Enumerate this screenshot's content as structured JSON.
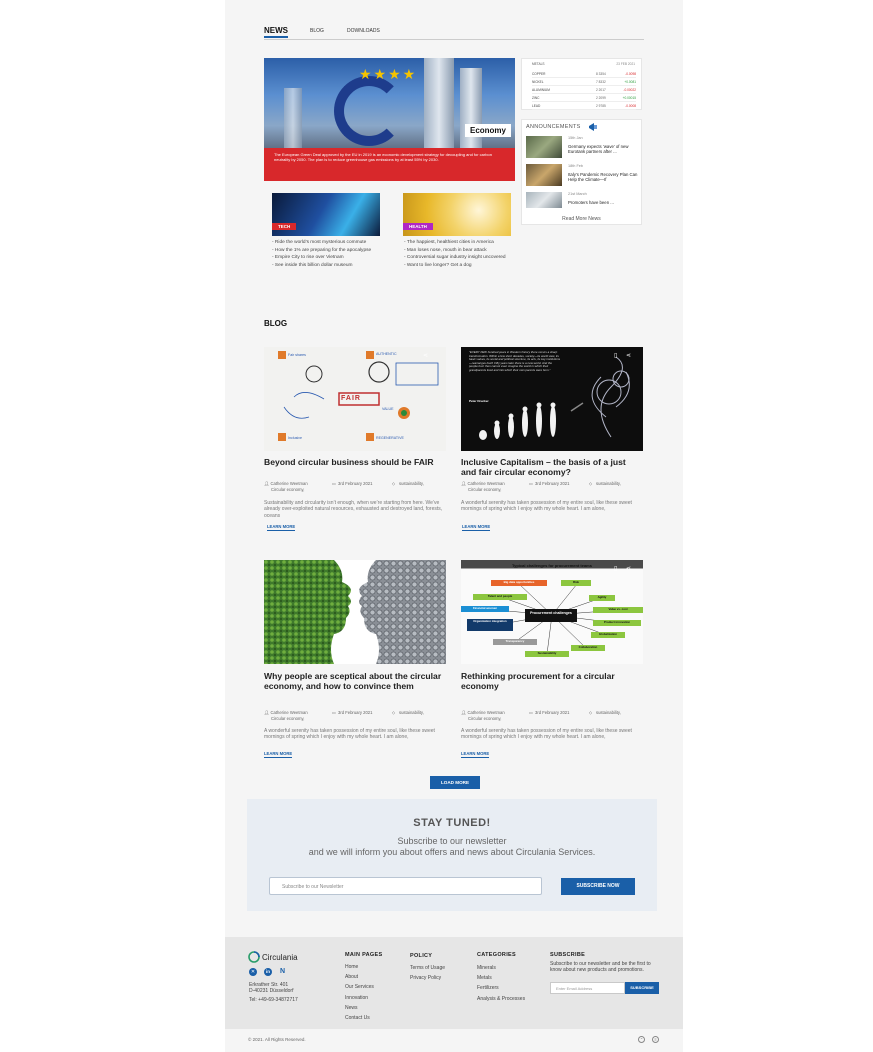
{
  "tabs": {
    "news": "NEWS",
    "blog": "BLOG",
    "downloads": "DOWNLOADS"
  },
  "hero": {
    "label": "Economy",
    "caption": "The European Green Deal approved by the EU in 2019 is an economic development strategy for decoupling and for carbon neutrality by 2050. The plan is to reduce greenhouse gas emissions by at least 55% by 2030."
  },
  "metals": {
    "header": "METALS",
    "date": "23 FEB 2021",
    "rows": [
      {
        "name": "COPPER",
        "price": "8 3354",
        "change": "-0.0098",
        "color": "#d8282b"
      },
      {
        "name": "NICKEL",
        "price": "7 8332",
        "change": "+0.0081",
        "color": "#2a9d3a"
      },
      {
        "name": "ALUMINIUM",
        "price": "2 2017",
        "change": "-0.00022",
        "color": "#d8282b"
      },
      {
        "name": "ZINC",
        "price": "2 2099",
        "change": "+0.00015",
        "color": "#2a9d3a"
      },
      {
        "name": "LEAD",
        "price": "2 9785",
        "change": "-0.0008",
        "color": "#d8282b"
      }
    ]
  },
  "announcements": {
    "title": "ANNOUNCEMENTS",
    "items": [
      {
        "date": "15th Jan",
        "headline": "Germany expects ‘wave’ of new Eurotank partners after ..."
      },
      {
        "date": "18th Feb",
        "headline": "Italy’s Pandemic Recovery Plan Can Help the Climate—If"
      },
      {
        "date": "21st March",
        "headline": "Promoters have been ..."
      }
    ],
    "more": "Read More News"
  },
  "tech": {
    "tag": "TECH",
    "items": [
      "- Ride the world’s most mysterious commute",
      "- How the 1% are preparing for the apocalypse",
      "- Empire City to rise over Vietnam",
      "- See inside this billion dollar museum"
    ]
  },
  "health": {
    "tag": "HEALTH",
    "items": [
      "- The happiest, healthiest cities in America",
      "- Man loses nose, mouth in bear attack",
      "- Controversial sugar industry insight uncovered",
      "- Want to live longer? Get a dog"
    ]
  },
  "blog": {
    "title": "BLOG",
    "posts": [
      {
        "title": "Beyond circular business should be FAIR",
        "author": "Catherine Weetman",
        "author2": "Circular economy,",
        "date": "3rd February 2021",
        "category": "sustainability,",
        "excerpt": "Sustainability and circularity isn’t enough, when we’re starting from here. We’ve already over-exploited natural resources, exhausted and destroyed land, forests, oceans",
        "link": "LEARN MORE"
      },
      {
        "title": "Inclusive Capitalism – the basis of a just and fair circular economy?",
        "author": "Catherine Weetman",
        "author2": "Circular economy,",
        "date": "3rd February 2021",
        "category": "sustainability,",
        "excerpt": "A wonderful serenity has taken possession of my entire soul, like these sweet mornings of spring which I enjoy with my whole heart. I am alone,",
        "link": "LEARN MORE",
        "quote": "\"EVERY FEW hundred years in Western history there occurs a sharp transformation. Within a few short decades, society—its world view, its basic values, its social and political structure, its arts, its key institutions—rearranges itself. Fifty years later there is a new world. And the people born then cannot even imagine the world in which their grandparents lived and into which their own parents were born.\"",
        "quote_author": "Peter Drucker"
      },
      {
        "title": "Why people are sceptical about the circular economy, and how to convince them",
        "author": "Catherine Weetman",
        "author2": "Circular economy,",
        "date": "3rd February 2021",
        "category": "sustainability,",
        "excerpt": "A wonderful serenity has taken possession of my entire soul, like these sweet mornings of spring which I enjoy with my whole heart. I am alone,",
        "link": "LEARN MORE"
      },
      {
        "title": "Rethinking procurement for a circular economy",
        "author": "Catherine Weetman",
        "author2": "Circular economy,",
        "date": "3rd February 2021",
        "category": "sustainability,",
        "excerpt": "A wonderful serenity has taken possession of my entire soul, like these sweet mornings of spring which I enjoy with my whole heart. I am alone,",
        "link": "LEARN MORE",
        "diagram_title": "Typical challenges for procurement teams",
        "diagram_center": "Procurement challenges",
        "diagram_nodes": [
          "Big data opportunities",
          "Risk",
          "Talent and people",
          "Agility",
          "Financial acumen",
          "Value vs. cost",
          "Organization integration",
          "Product innovation",
          "Transparency",
          "Globalization",
          "Sustainability",
          "Collaboration"
        ]
      }
    ],
    "load_more": "LOAD MORE"
  },
  "whiteboard": {
    "words": [
      "FAIR",
      "Fair shares",
      "AUTHENTIC",
      "Inclusive",
      "REGENERATIVE",
      "VALUE"
    ]
  },
  "newsletter": {
    "heading": "STAY TUNED!",
    "line1": "Subscribe to our newsletter",
    "line2": "and we will inform you about offers and news about Circulania Services.",
    "placeholder": "Subscribe to our Newsletter",
    "button": "SUBSCRIBE NOW"
  },
  "footer": {
    "brand": "Circulania",
    "address1": "Erkrather Str. 401",
    "address2": "D-40231 Düsseldorf",
    "phone": "Tel: +49-69-34872717",
    "main_pages_title": "MAIN PAGES",
    "main_pages": [
      "Home",
      "About",
      "Our Services",
      "Innovation",
      "News",
      "Contact Us"
    ],
    "policy_title": "POLICY",
    "policy": [
      "Terms of Usage",
      "Privacy Policy"
    ],
    "categories_title": "CATEGORIES",
    "categories": [
      "Minerals",
      "Metals",
      "Fertilizers",
      "Analysis & Processes"
    ],
    "subscribe_title": "SUBSCRIBE",
    "subscribe_text": "Subscribe to our newsletter and be the first to know about new products and promotions.",
    "email_placeholder": "Enter Email Address",
    "subscribe_button": "SUBSCRIBE"
  },
  "copyright": "© 2021. All Rights Reserved.",
  "colors": {
    "accent": "#1a5fa8",
    "hero_band": "#d8282b",
    "tech_tag": "#d8282b",
    "health_tag": "#b026c4"
  }
}
